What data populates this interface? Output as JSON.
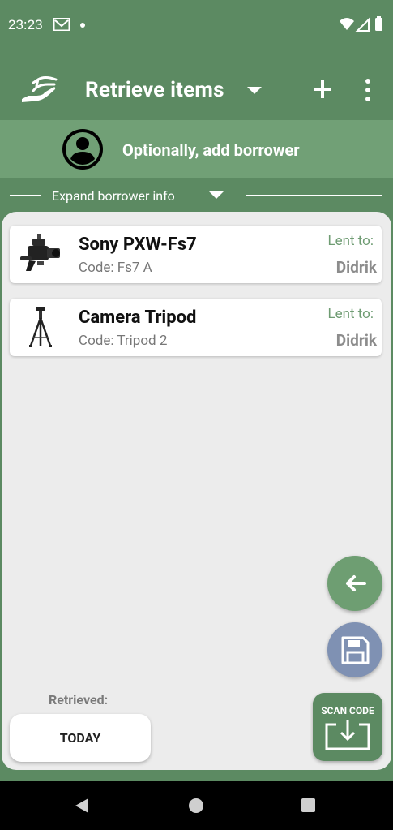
{
  "status_bar": {
    "time": "23:23"
  },
  "app_bar": {
    "title": "Retrieve items"
  },
  "borrower": {
    "label": "Optionally, add borrower"
  },
  "expand": {
    "label": "Expand borrower info"
  },
  "items": [
    {
      "name": "Sony PXW-Fs7",
      "code": "Code: Fs7 A",
      "lent_label": "Lent to:",
      "lent_to": "Didrik"
    },
    {
      "name": "Camera Tripod",
      "code": "Code: Tripod 2",
      "lent_label": "Lent to:",
      "lent_to": "Didrik"
    }
  ],
  "retrieved": {
    "label": "Retrieved:",
    "date_button": "TODAY"
  },
  "scan": {
    "label": "SCAN CODE"
  },
  "colors": {
    "primary": "#5c8a62",
    "borrower_bar": "#71a076",
    "save_fab": "#7f91b3"
  }
}
